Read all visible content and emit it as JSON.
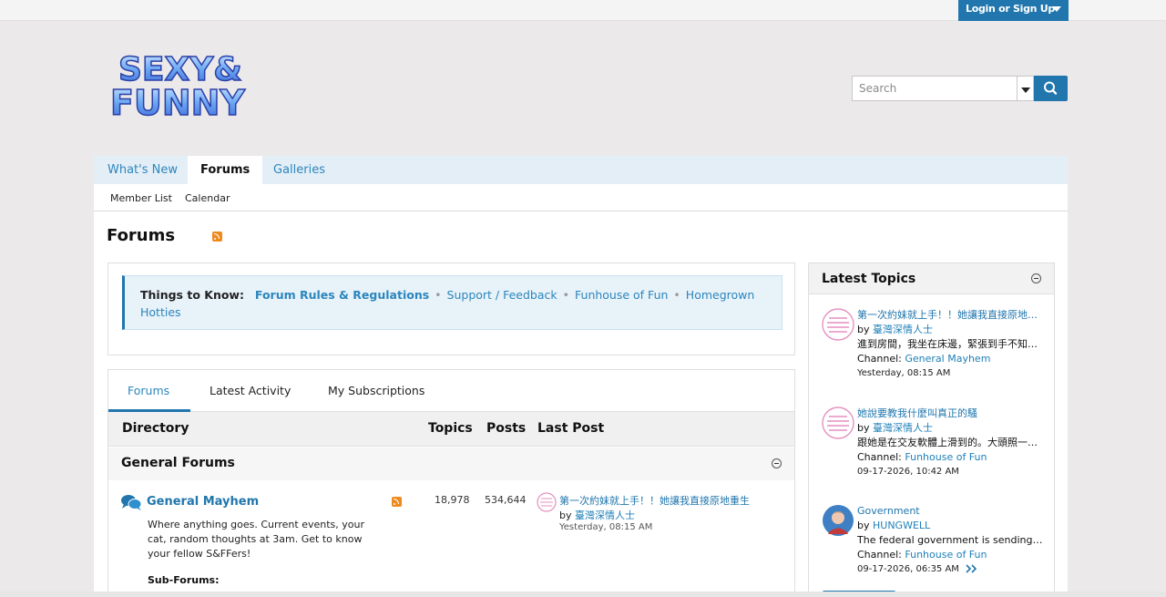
{
  "header": {
    "login_label": "Login or Sign Up",
    "logo_text_line1": "SEXY&",
    "logo_text_line2": "FUNNY",
    "search_placeholder": "Search"
  },
  "nav": {
    "tabs": [
      {
        "label": "What's New"
      },
      {
        "label": "Forums"
      },
      {
        "label": "Galleries"
      }
    ],
    "subnav": [
      {
        "label": "Member List"
      },
      {
        "label": "Calendar"
      }
    ]
  },
  "page": {
    "title": "Forums"
  },
  "things_to_know": {
    "label": "Things to Know:",
    "links": [
      {
        "label": "Forum Rules & Regulations"
      },
      {
        "label": "Support / Feedback"
      },
      {
        "label": "Funhouse of Fun"
      },
      {
        "label": "Homegrown Hotties"
      }
    ]
  },
  "forum_tabs": [
    {
      "label": "Forums"
    },
    {
      "label": "Latest Activity"
    },
    {
      "label": "My Subscriptions"
    }
  ],
  "directory": {
    "col_directory": "Directory",
    "col_topics": "Topics",
    "col_posts": "Posts",
    "col_last_post": "Last Post",
    "section_title": "General Forums"
  },
  "forum_row": {
    "name": "General Mayhem",
    "description": "Where anything goes. Current events, your cat, random thoughts at 3am. Get to know your fellow S&FFers!",
    "subforums_label": "Sub-Forums:",
    "topics": "18,978",
    "posts": "534,644",
    "last_post_title": "第一次約妹就上手！！她讓我直接原地重生",
    "last_post_by_prefix": "by",
    "last_post_author": "臺灣深情人士",
    "last_post_time": "Yesterday, 08:15 AM"
  },
  "sidebar": {
    "title": "Latest Topics",
    "topics": [
      {
        "title": "第一次約妹就上手！！她讓我直接原地重...",
        "by_prefix": "by",
        "author": "臺灣深情人士",
        "excerpt": "進到房間，我坐在床邊，緊張到手不知道...",
        "channel_label": "Channel:",
        "channel": "General Mayhem",
        "time": "Yesterday, 08:15 AM"
      },
      {
        "title": "她說要教我什麼叫真正的騷",
        "by_prefix": "by",
        "author": "臺灣深情人士",
        "excerpt": "跟她是在交友軟體上滑到的。大頭照一張...",
        "channel_label": "Channel:",
        "channel": "Funhouse of Fun",
        "time": "09-17-2026, 10:42 AM"
      },
      {
        "title": "Government",
        "by_prefix": "by",
        "author": "HUNGWELL",
        "excerpt": "The federal government is sending ...",
        "channel_label": "Channel:",
        "channel": "Funhouse of Fun",
        "time": "09-17-2026, 06:35 AM"
      }
    ]
  },
  "colors": {
    "accent": "#2076ad",
    "link": "#2b86bd",
    "nav_bg": "#e4eef6",
    "rss": "#ee8a1e"
  }
}
